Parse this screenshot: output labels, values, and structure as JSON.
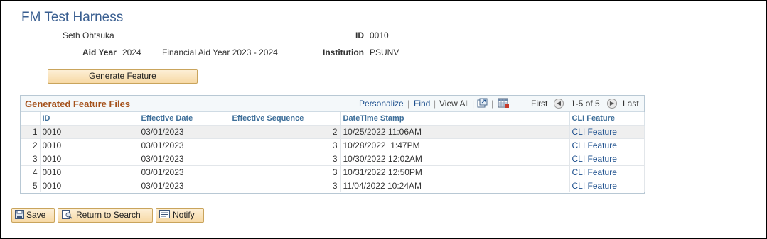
{
  "page": {
    "title": "FM Test Harness"
  },
  "header": {
    "name": "Seth Ohtsuka",
    "id_label": "ID",
    "id_value": "0010",
    "aid_year_label": "Aid Year",
    "aid_year_value": "2024",
    "aid_year_desc": "Financial Aid Year 2023 - 2024",
    "institution_label": "Institution",
    "institution_value": "PSUNV"
  },
  "actions": {
    "generate": "Generate Feature"
  },
  "grid": {
    "title": "Generated Feature Files",
    "personalize": "Personalize",
    "find": "Find",
    "view_all": "View All",
    "first": "First",
    "range": "1-5 of 5",
    "last": "Last",
    "columns": [
      "ID",
      "Effective Date",
      "Effective Sequence",
      "DateTime Stamp",
      "CLI Feature"
    ],
    "rows": [
      {
        "num": "1",
        "id": "0010",
        "eff_date": "03/01/2023",
        "eff_seq": "2",
        "stamp": "10/25/2022 11:06AM",
        "cli": "CLI Feature"
      },
      {
        "num": "2",
        "id": "0010",
        "eff_date": "03/01/2023",
        "eff_seq": "3",
        "stamp": "10/28/2022  1:47PM",
        "cli": "CLI Feature"
      },
      {
        "num": "3",
        "id": "0010",
        "eff_date": "03/01/2023",
        "eff_seq": "3",
        "stamp": "10/30/2022 12:02AM",
        "cli": "CLI Feature"
      },
      {
        "num": "4",
        "id": "0010",
        "eff_date": "03/01/2023",
        "eff_seq": "3",
        "stamp": "10/31/2022 12:50PM",
        "cli": "CLI Feature"
      },
      {
        "num": "5",
        "id": "0010",
        "eff_date": "03/01/2023",
        "eff_seq": "3",
        "stamp": "11/04/2022 10:24AM",
        "cli": "CLI Feature"
      }
    ]
  },
  "toolbar": {
    "save": "Save",
    "return": "Return to Search",
    "notify": "Notify"
  }
}
